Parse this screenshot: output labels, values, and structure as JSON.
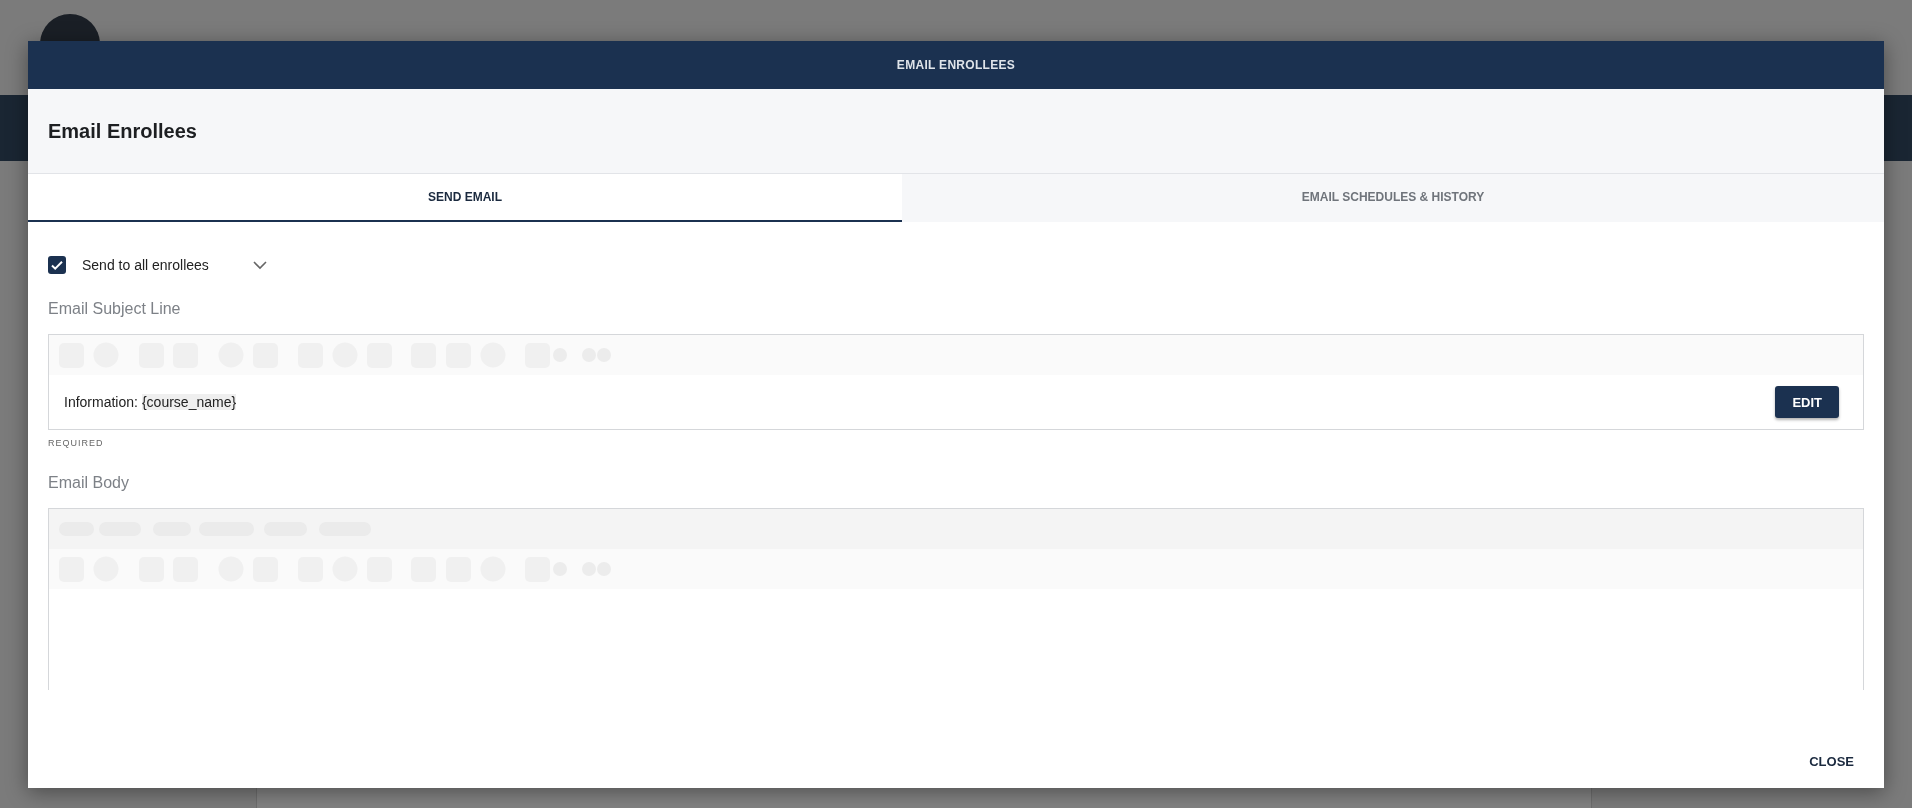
{
  "dialog": {
    "title": "EMAIL ENROLLEES",
    "heading": "Email Enrollees"
  },
  "tabs": [
    {
      "label": "SEND EMAIL",
      "selected": true
    },
    {
      "label": "EMAIL SCHEDULES & HISTORY",
      "selected": false
    }
  ],
  "recipients": {
    "label": "Send to all enrollees",
    "checked": true
  },
  "subject": {
    "label": "Email Subject Line",
    "text": "Information:",
    "token": "{course_name}",
    "button": "EDIT",
    "helper": "REQUIRED"
  },
  "body": {
    "label": "Email Body"
  },
  "footer": {
    "button": "CLOSE"
  }
}
